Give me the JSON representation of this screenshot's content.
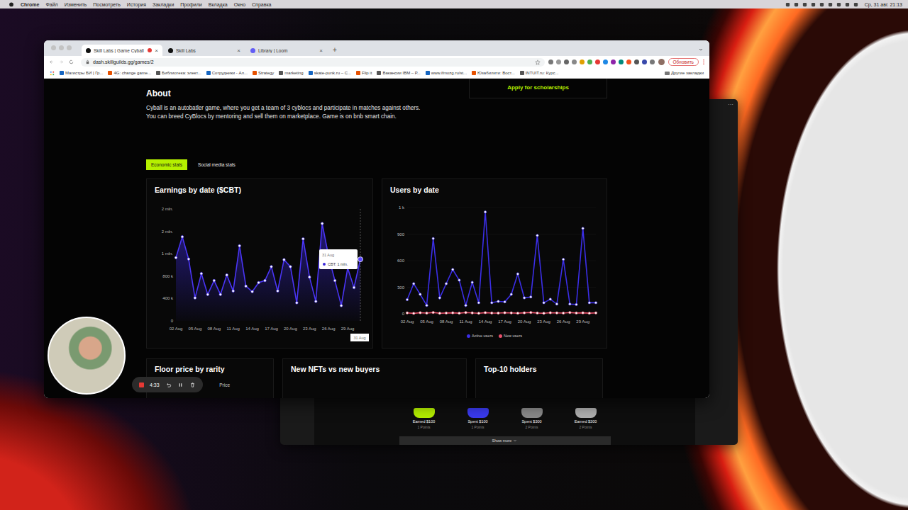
{
  "menu_bar": {
    "app": "Chrome",
    "items": [
      "Файл",
      "Изменить",
      "Посмотреть",
      "История",
      "Закладки",
      "Профили",
      "Вкладка",
      "Окно",
      "Справка"
    ],
    "clock": "Ср, 31 авг. 21:13"
  },
  "browser": {
    "tabs": [
      {
        "title": "Skill Labs | Game Cyball",
        "selected": true,
        "recording": true,
        "favicon": "#111111"
      },
      {
        "title": "Skill Labs",
        "selected": false,
        "recording": false,
        "favicon": "#111111"
      },
      {
        "title": "Library | Loom",
        "selected": false,
        "recording": false,
        "favicon": "#625df5"
      }
    ],
    "tab_close": "×",
    "new_tab": "+",
    "address": "dash.skillguilds.gg/games/2",
    "update_button": "Обновить",
    "bookmarks": [
      "Магистры БИ | Гр...",
      "4G: change game...",
      "Библиотека: элект...",
      "Сотрудники - Ал...",
      "Strategy",
      "marketing",
      "skate-punk.ru – С...",
      "Flip it",
      "Вакансии IBM – Р...",
      "www.ifmozg.ru/st...",
      "Юзабилити: Вост...",
      "INTUIT.ru: Курс..."
    ],
    "other_bookmarks": "Другие закладки"
  },
  "page": {
    "scholarship_link": "Apply for scholarships",
    "about_title": "About",
    "about_lines": [
      "Cyball is an autobatler game, where you get a team of 3 cyblocs and participate in matches against others.",
      "You can breed CyBlocs by mentoring and sell them on marketplace. Game is on bnb smart chain."
    ],
    "stat_tabs": [
      {
        "label": "Economic stats",
        "selected": true
      },
      {
        "label": "Social media stats",
        "selected": false
      }
    ],
    "charts": {
      "earnings": {
        "title": "Earnings by date ($CBT)",
        "y_ticks": [
          "0",
          "400 k",
          "800 k",
          "1 mln.",
          "2 mln.",
          "2 mln."
        ],
        "x_ticks": [
          "02 Aug",
          "05 Aug",
          "08 Aug",
          "11 Aug",
          "14 Aug",
          "17 Aug",
          "20 Aug",
          "23 Aug",
          "26 Aug",
          "29 Aug"
        ],
        "values": [
          1130000,
          1503000,
          1105000,
          410000,
          845000,
          472000,
          720000,
          472000,
          820000,
          534000,
          1342000,
          621000,
          522000,
          683000,
          720000,
          969000,
          534000,
          1093000,
          969000,
          323000,
          1466000,
          783000,
          348000,
          1739000,
          1155000,
          720000,
          273000,
          944000,
          596000,
          1100000
        ],
        "highlight_date": "31 Aug",
        "tooltip": {
          "date": "31 Aug",
          "label": "CBT: 1 mln."
        }
      },
      "users": {
        "title": "Users by date",
        "y_ticks": [
          "0",
          "300",
          "600",
          "900",
          "1 k"
        ],
        "x_ticks": [
          "02 Aug",
          "05 Aug",
          "08 Aug",
          "11 Aug",
          "14 Aug",
          "17 Aug",
          "20 Aug",
          "23 Aug",
          "26 Aug",
          "29 Aug"
        ],
        "series": [
          {
            "name": "Active users",
            "color": "#3b2ee6",
            "values": [
              160,
              340,
              220,
              95,
              850,
              180,
              340,
              500,
              380,
              95,
              355,
              125,
              1150,
              125,
              140,
              135,
              220,
              450,
              180,
              190,
              885,
              125,
              165,
              110,
              615,
              110,
              105,
              965,
              125,
              125
            ]
          },
          {
            "name": "New users",
            "color": "#e8506a",
            "values": [
              10,
              5,
              12,
              8,
              15,
              6,
              9,
              11,
              7,
              14,
              10,
              6,
              13,
              9,
              8,
              12,
              10,
              7,
              11,
              15,
              9,
              6,
              12,
              10,
              8,
              14,
              9,
              11,
              7,
              10
            ]
          }
        ]
      }
    },
    "bottom_cards": [
      {
        "title": "Floor price by rarity",
        "label": "Price"
      },
      {
        "title": "New NFTs vs new buyers",
        "label": ""
      },
      {
        "title": "Top-10 holders",
        "label": ""
      }
    ]
  },
  "back_window": {
    "menu": "···",
    "items": [
      {
        "label": "Earned $100",
        "sub": "1 Points",
        "color": "#b5f000"
      },
      {
        "label": "Spent $100",
        "sub": "1 Points",
        "color": "#3a3af0"
      },
      {
        "label": "Spent $300",
        "sub": "2 Points",
        "color": "#8a8a8a"
      },
      {
        "label": "Earned $300",
        "sub": "2 Points",
        "color": "#b0b0b0"
      }
    ],
    "show_more": "Show more"
  },
  "recorder": {
    "time": "4:33"
  }
}
